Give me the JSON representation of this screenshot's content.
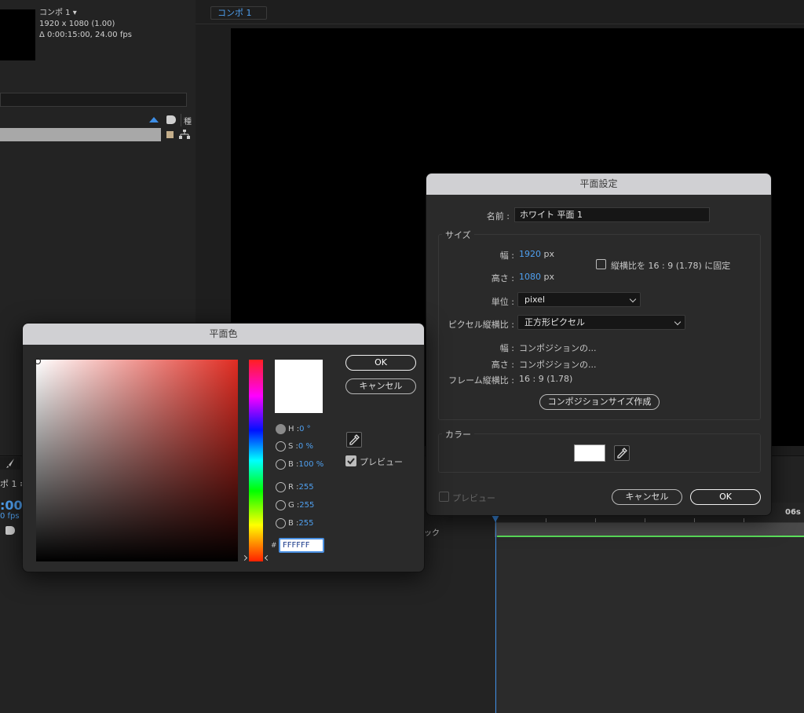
{
  "project": {
    "comp_name": "コンポ 1 ▾",
    "comp_size": "1920 x 1080 (1.00)",
    "comp_duration": "Δ 0:00:15:00, 24.00 fps",
    "header_extra": "種"
  },
  "viewer": {
    "tab_label": "コンポ 1"
  },
  "timeline": {
    "comp_label": "ポ 1 ≡",
    "time": ":00",
    "fps": "0 fps",
    "column_label": "ック",
    "ruler_label": "06s"
  },
  "color_picker": {
    "title": "平面色",
    "ok_label": "OK",
    "cancel_label": "キャンセル",
    "preview_label": "プレビュー",
    "preview_checked": true,
    "current_color": "#FFFFFF",
    "hue_color": "#E02C22",
    "h": {
      "label": "H :",
      "value": "0 °"
    },
    "s": {
      "label": "S :",
      "value": "0 %"
    },
    "b": {
      "label": "B :",
      "value": "100 %"
    },
    "r": {
      "label": "R :",
      "value": "255"
    },
    "g": {
      "label": "G :",
      "value": "255"
    },
    "b2": {
      "label": "B :",
      "value": "255"
    },
    "hex_prefix": "#",
    "hex_value": "FFFFFF"
  },
  "solid_settings": {
    "title": "平面設定",
    "name_label": "名前 :",
    "name_value": "ホワイト 平面 1",
    "size_group": "サイズ",
    "width_label": "幅 :",
    "width_value": "1920",
    "width_unit": "px",
    "height_label": "高さ :",
    "height_value": "1080",
    "height_unit": "px",
    "lock_label": "縦横比を 16 : 9 (1.78) に固定",
    "unit_label": "単位 :",
    "unit_value": "pixel",
    "par_label": "ピクセル縦横比 :",
    "par_value": "正方形ピクセル",
    "w_pct_label": "幅 :",
    "w_pct_value": "コンポジションの...",
    "h_pct_label": "高さ :",
    "h_pct_value": "コンポジションの...",
    "frame_ar_label": "フレーム縦横比 :",
    "frame_ar_value": "16 : 9 (1.78)",
    "make_comp_size_label": "コンポジションサイズ作成",
    "color_group": "カラー",
    "color_value": "#FFFFFF",
    "preview_label": "プレビュー",
    "cancel_label": "キャンセル",
    "ok_label": "OK"
  }
}
